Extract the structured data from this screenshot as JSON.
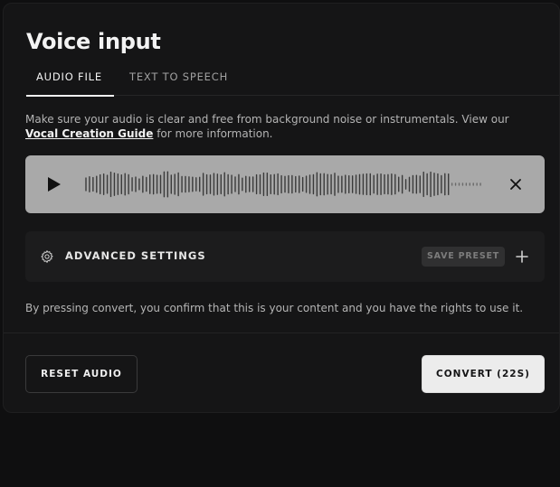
{
  "panel": {
    "title": "Voice input"
  },
  "tabs": [
    {
      "label": "AUDIO FILE",
      "active": true
    },
    {
      "label": "TEXT TO SPEECH",
      "active": false
    }
  ],
  "info": {
    "text_before": "Make sure your audio is clear and free from background noise or instrumentals. View our ",
    "link_text": "Vocal Creation Guide",
    "text_after": " for more information."
  },
  "player": {
    "play_icon": "play-icon",
    "close_icon": "close-icon",
    "played_color": "#3a3a3a",
    "remaining_color": "#6a6a6a"
  },
  "advanced": {
    "label": "ADVANCED SETTINGS",
    "save_preset_label": "SAVE PRESET",
    "icon": "gear-icon",
    "add_icon": "plus-icon"
  },
  "consent": "By pressing convert, you confirm that this is your content and you have the rights to use it.",
  "actions": {
    "reset_label": "RESET AUDIO",
    "convert_label": "CONVERT (22S)"
  }
}
